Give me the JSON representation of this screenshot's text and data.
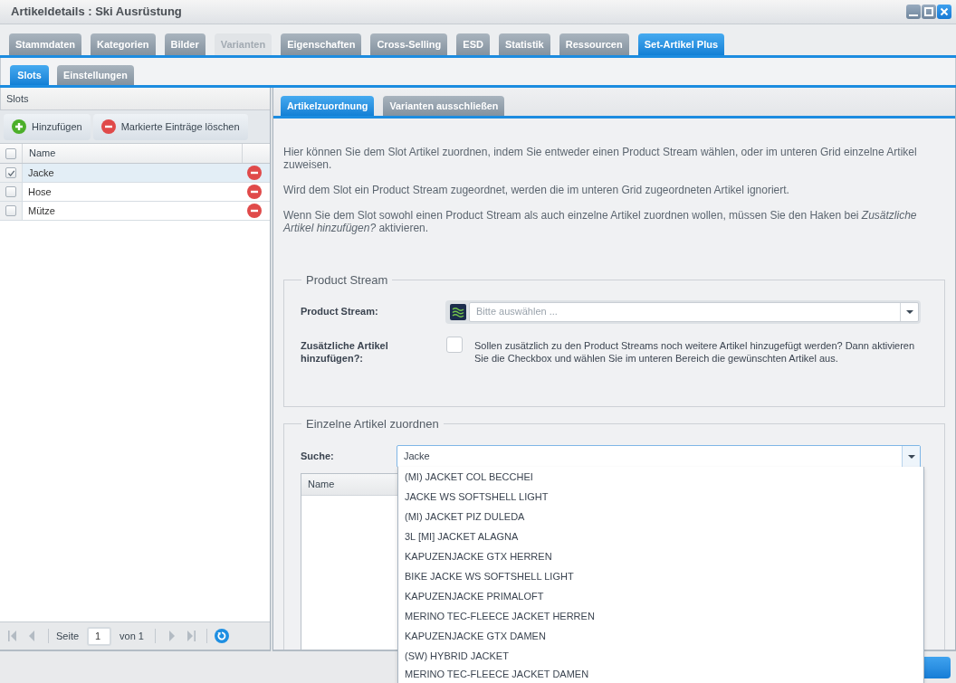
{
  "window": {
    "title": "Artikeldetails : Ski Ausrüstung"
  },
  "tabs": [
    {
      "label": "Stammdaten",
      "selected": false,
      "disabled": false
    },
    {
      "label": "Kategorien",
      "selected": false,
      "disabled": false
    },
    {
      "label": "Bilder",
      "selected": false,
      "disabled": false
    },
    {
      "label": "Varianten",
      "selected": false,
      "disabled": true
    },
    {
      "label": "Eigenschaften",
      "selected": false,
      "disabled": false
    },
    {
      "label": "Cross-Selling",
      "selected": false,
      "disabled": false
    },
    {
      "label": "ESD",
      "selected": false,
      "disabled": false
    },
    {
      "label": "Statistik",
      "selected": false,
      "disabled": false
    },
    {
      "label": "Ressourcen",
      "selected": false,
      "disabled": false
    },
    {
      "label": "Set-Artikel Plus",
      "selected": true,
      "disabled": false
    }
  ],
  "sub_tabs": [
    {
      "label": "Slots",
      "selected": true
    },
    {
      "label": "Einstellungen",
      "selected": false
    }
  ],
  "slots": {
    "title": "Slots",
    "toolbar": [
      {
        "kind": "add",
        "label": "Hinzufügen"
      },
      {
        "kind": "remove",
        "label": "Markierte Einträge löschen"
      }
    ],
    "grid": {
      "all_checked": false,
      "columns": [
        "Name"
      ],
      "rows": [
        {
          "name": "Jacke",
          "checked": true,
          "selected": true
        },
        {
          "name": "Hose",
          "checked": false,
          "selected": false
        },
        {
          "name": "Mütze",
          "checked": false,
          "selected": false
        }
      ]
    },
    "pager": {
      "nav_disabled": true,
      "page_label": "Seite",
      "page": "1",
      "total": "von 1"
    }
  },
  "detail_tabs": [
    {
      "label": "Artikelzuordnung",
      "selected": true
    },
    {
      "label": "Varianten ausschließen",
      "selected": false
    }
  ],
  "intro": [
    "Hier können Sie dem Slot Artikel zuordnen, indem Sie entweder einen Product Stream wählen, oder im unteren Grid einzelne Artikel zuweisen.",
    "Wird dem Slot ein Product Stream zugeordnet, werden die im unteren Grid zugeordneten Artikel ignoriert.",
    "Wenn Sie dem Slot sowohl einen Product Stream als auch einzelne Artikel zuordnen wollen, müssen Sie den Haken bei *Zusätzliche Artikel hinzufügen?* aktivieren."
  ],
  "product_stream": {
    "legend": "Product Stream",
    "stream_label": "Product Stream:",
    "stream_placeholder": "Bitte auswählen ...",
    "extra_label": "Zusätzliche Artikel hinzufügen?:",
    "extra_checked": false,
    "extra_hint": "Sollen zusätzlich zu den Product Streams noch weitere Artikel hinzugefügt werden? Dann aktivieren Sie die Checkbox und wählen Sie im unteren Bereich die gewünschten Artikel aus."
  },
  "single_articles": {
    "legend": "Einzelne Artikel zuordnen",
    "search_label": "Suche:",
    "search_value": "Jacke",
    "grid_columns": [
      "Name"
    ],
    "suggestions": [
      "(MI) JACKET COL BECCHEI",
      "JACKE WS SOFTSHELL LIGHT",
      "(MI) JACKET PIZ DULEDA",
      "3L [MI] JACKET ALAGNA",
      "KAPUZENJACKE GTX HERREN",
      "BIKE JACKE WS SOFTSHELL LIGHT",
      "KAPUZENJACKE PRIMALOFT",
      "MERINO TEC-FLEECE JACKET HERREN",
      "KAPUZENJACKE GTX DAMEN",
      "(SW) HYBRID JACKET",
      "MERINO TEC-FLEECE JACKET DAMEN"
    ]
  }
}
